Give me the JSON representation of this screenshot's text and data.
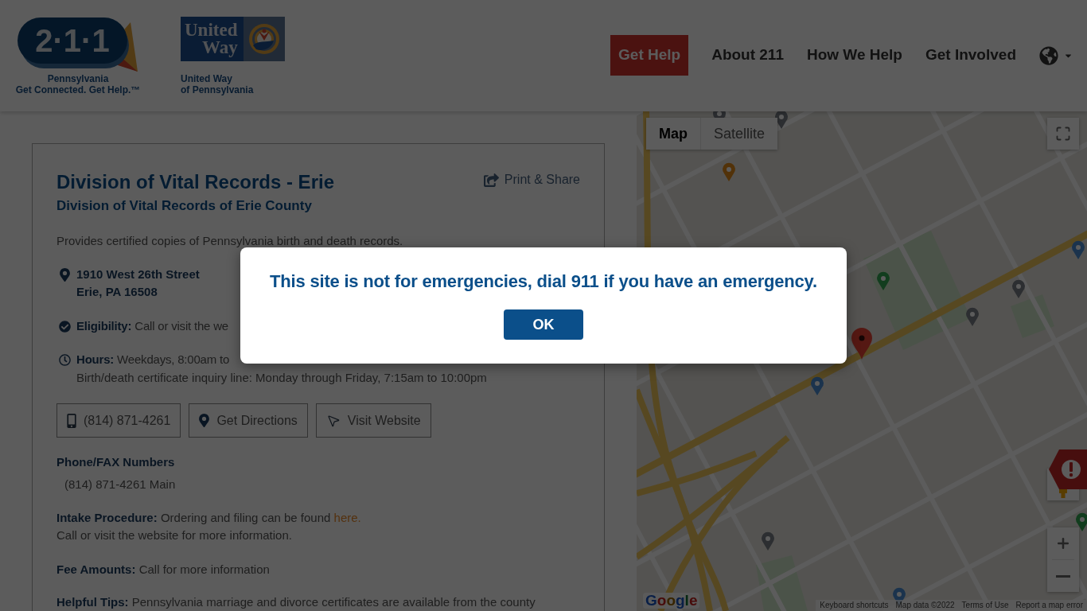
{
  "header": {
    "logo_211": {
      "mark": "2·1·1",
      "caption": [
        "Pennsylvania",
        "Get Connected. Get Help.™"
      ]
    },
    "logo_united_way": {
      "mark": [
        "United",
        "Way"
      ],
      "caption": [
        "United Way",
        "of Pennsylvania"
      ]
    },
    "nav": [
      {
        "label": "Get Help",
        "kind": "button"
      },
      {
        "label": "About 211",
        "kind": "link"
      },
      {
        "label": "How We Help",
        "kind": "link"
      },
      {
        "label": "Get Involved",
        "kind": "link"
      }
    ]
  },
  "service": {
    "title": "Division of Vital Records - Erie",
    "subtitle": "Division of Vital Records of Erie County",
    "print_share": "Print & Share",
    "description": "Provides certified copies of Pennsylvania birth and death records.",
    "address": [
      "1910 West 26th Street",
      "Erie, PA 16508"
    ],
    "eligibility": {
      "label": "Eligibility:",
      "text": "Call or visit the we"
    },
    "hours": {
      "label": "Hours:",
      "text": "Weekdays, 8:00am to",
      "note": "Birth/death certificate inquiry line: Monday through Friday, 7:15am to 10:00pm"
    },
    "actions": [
      {
        "kind": "phone",
        "label": "(814) 871-4261"
      },
      {
        "kind": "directions",
        "label": "Get Directions"
      },
      {
        "kind": "website",
        "label": "Visit Website"
      }
    ],
    "phone_numbers": {
      "heading": "Phone/FAX Numbers",
      "items": [
        "(814) 871-4261 Main"
      ]
    },
    "intake": {
      "label": "Intake Procedure:",
      "text": "Ordering and filing can be found",
      "link": "here.",
      "note": "Call or visit the website for more information."
    },
    "fees": {
      "label": "Fee Amounts:",
      "text": "Call for more information"
    },
    "tips": {
      "label": "Helpful Tips:",
      "text": "Pennsylvania marriage and divorce certificates are available from the county"
    }
  },
  "map": {
    "view_tabs": [
      {
        "label": "Map",
        "selected": true
      },
      {
        "label": "Satellite",
        "selected": false
      }
    ],
    "logo": "Google",
    "footer_links": [
      "Keyboard shortcuts",
      "Map data ©2022",
      "Terms of Use",
      "Report a map error"
    ]
  },
  "dialog": {
    "message": "This site is not for emergencies, dial 911 if you have an emergency.",
    "button": "OK"
  }
}
